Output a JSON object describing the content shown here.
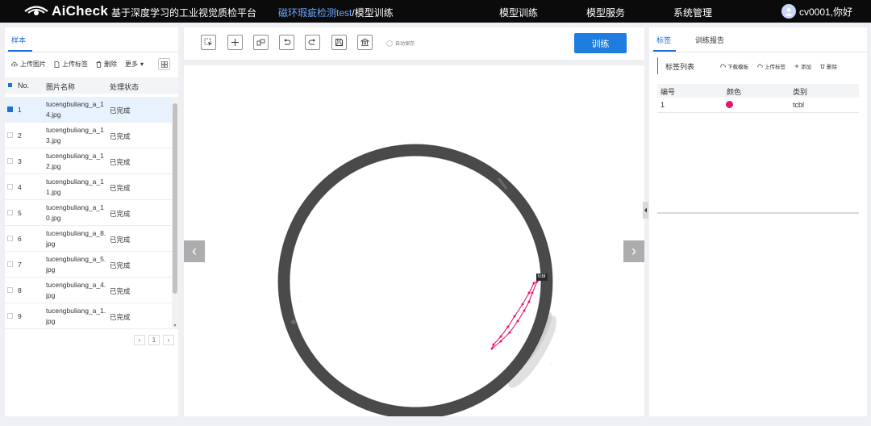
{
  "header": {
    "logo_text": "AiCheck",
    "platform_title": "基于深度学习的工业视觉质检平台",
    "breadcrumb_project": "磁环瑕疵检测test",
    "breadcrumb_sep": "/",
    "breadcrumb_page": "模型训练",
    "nav": [
      "模型训练",
      "模型服务",
      "系统管理"
    ],
    "user_name": "cv0001,你好"
  },
  "left_panel": {
    "tab": "样本",
    "toolbar": {
      "upload_image": "上传图片",
      "upload_label": "上传标签",
      "delete": "删除",
      "more": "更多",
      "more_caret": "▾"
    },
    "table_header": {
      "no": "No.",
      "name": "图片名称",
      "status": "处理状态"
    },
    "rows": [
      {
        "no": "1",
        "name": "tucengbuliang_a_14.jpg",
        "status": "已完成",
        "selected": true
      },
      {
        "no": "2",
        "name": "tucengbuliang_a_13.jpg",
        "status": "已完成"
      },
      {
        "no": "3",
        "name": "tucengbuliang_a_12.jpg",
        "status": "已完成"
      },
      {
        "no": "4",
        "name": "tucengbuliang_a_11.jpg",
        "status": "已完成"
      },
      {
        "no": "5",
        "name": "tucengbuliang_a_10.jpg",
        "status": "已完成"
      },
      {
        "no": "6",
        "name": "tucengbuliang_a_8.jpg",
        "status": "已完成"
      },
      {
        "no": "7",
        "name": "tucengbuliang_a_5.jpg",
        "status": "已完成"
      },
      {
        "no": "8",
        "name": "tucengbuliang_a_4.jpg",
        "status": "已完成"
      },
      {
        "no": "9",
        "name": "tucengbuliang_a_1.jpg",
        "status": "已完成"
      }
    ],
    "pagination": {
      "prev": "‹",
      "page": "1",
      "next": "›"
    }
  },
  "center": {
    "tools": [
      "select-icon",
      "crosshair-icon",
      "polygon-icon",
      "undo-icon",
      "redo-icon",
      "save-icon",
      "bank-icon"
    ],
    "autosave_label": "自动保存",
    "train_button": "训练",
    "annotation_tag": "tcbl",
    "prev_arrow": "‹",
    "next_arrow": "›"
  },
  "right_panel": {
    "tabs": [
      "标签",
      "训练报告"
    ],
    "label_list_title": "标签列表",
    "tools": {
      "download_template": "下载模板",
      "upload_label": "上传标签",
      "add": "添加",
      "delete": "删除"
    },
    "table_header": {
      "id": "编号",
      "color": "颜色",
      "category": "类别"
    },
    "labels": [
      {
        "id": "1",
        "color": "#e8136f",
        "category": "tcbl"
      }
    ]
  },
  "colors": {
    "accent": "#1e6fd9",
    "train_button": "#1f7de0",
    "topbar": "#0b0b0b",
    "annotation": "#e8136f"
  }
}
